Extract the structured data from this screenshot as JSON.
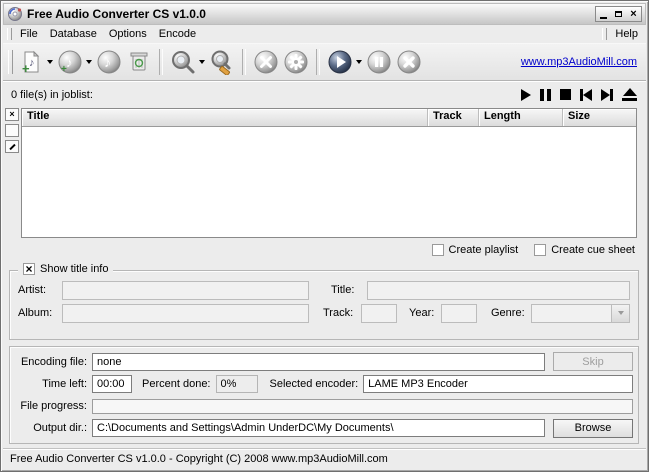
{
  "window": {
    "title": "Free Audio Converter CS v1.0.0"
  },
  "menu": {
    "items": [
      {
        "label": "File"
      },
      {
        "label": "Database"
      },
      {
        "label": "Options"
      },
      {
        "label": "Encode"
      }
    ],
    "help": {
      "label": "Help"
    }
  },
  "toolbar": {
    "website_link": "www.mp3AudioMill.com",
    "icons": [
      "add-files",
      "add-folder",
      "play-track",
      "clear-joblist",
      "cd-lookup",
      "cddb-edit",
      "tools",
      "settings",
      "start-encoding",
      "pause-encoding",
      "stop-encoding"
    ]
  },
  "joblist": {
    "count_text": "0 file(s) in joblist:",
    "columns": [
      {
        "label": "Title"
      },
      {
        "label": "Track"
      },
      {
        "label": "Length"
      },
      {
        "label": "Size"
      }
    ],
    "transport": [
      "play",
      "pause",
      "stop",
      "previous",
      "next",
      "eject"
    ]
  },
  "playlist_options": {
    "create_playlist": "Create playlist",
    "create_cue_sheet": "Create cue sheet"
  },
  "title_info": {
    "legend": "Show title info",
    "artist_label": "Artist:",
    "artist_value": "",
    "title_label": "Title:",
    "title_value": "",
    "album_label": "Album:",
    "album_value": "",
    "track_label": "Track:",
    "track_value": "",
    "year_label": "Year:",
    "year_value": "",
    "genre_label": "Genre:",
    "genre_value": ""
  },
  "encoding": {
    "file_label": "Encoding file:",
    "file_value": "none",
    "skip_button": "Skip",
    "time_left_label": "Time left:",
    "time_left_value": "00:00",
    "percent_label": "Percent done:",
    "percent_value": "0%",
    "encoder_label": "Selected encoder:",
    "encoder_value": "LAME MP3 Encoder",
    "progress_label": "File progress:",
    "output_label": "Output dir.:",
    "output_value": "C:\\Documents and Settings\\Admin UnderDC\\My Documents\\",
    "browse_button": "Browse"
  },
  "statusbar": {
    "text": "Free Audio Converter CS v1.0.0 - Copyright (C) 2008 www.mp3AudioMill.com"
  },
  "colors": {
    "dialog_bg": "#ececec",
    "link_blue": "#0000cc",
    "disabled_text": "#9e9e9e",
    "field_white": "#ffffff",
    "field_disabled": "#f1f1f1"
  }
}
